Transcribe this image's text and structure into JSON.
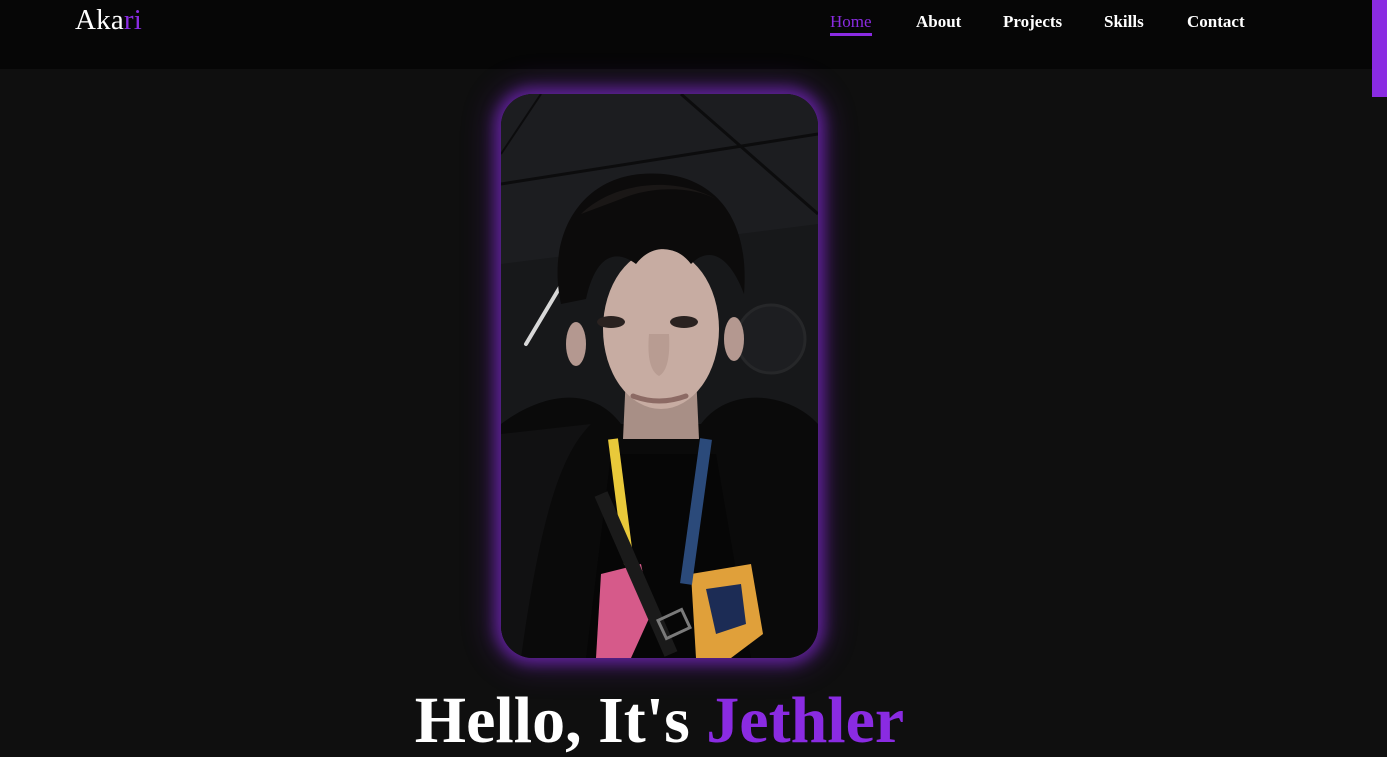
{
  "header": {
    "logo_main": "Aka",
    "logo_accent": "ri",
    "nav": [
      {
        "label": "Home",
        "active": true
      },
      {
        "label": "About",
        "active": false
      },
      {
        "label": "Projects",
        "active": false
      },
      {
        "label": "Skills",
        "active": false
      },
      {
        "label": "Contact",
        "active": false
      }
    ]
  },
  "hero": {
    "greeting": "Hello, It's ",
    "name": "Jethler",
    "photo_icon": "portrait-photo"
  },
  "colors": {
    "accent": "#8a2be2",
    "background": "#0f0f0f",
    "header_bg": "#060606",
    "text": "#ffffff"
  }
}
